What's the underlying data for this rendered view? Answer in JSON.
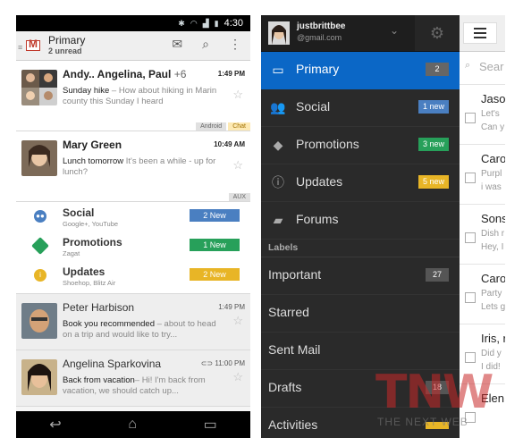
{
  "left": {
    "status_bar": {
      "time": "4:30"
    },
    "action_bar": {
      "title": "Primary",
      "subtitle": "2 unread"
    },
    "emails_top": [
      {
        "sender": "Andy.. Angelina, Paul",
        "more": "+6",
        "time": "1:49 PM",
        "subject": "Sunday hike",
        "snippet": " – How about hiking in Marin county this Sunday I heard",
        "labels": [
          "Android",
          "Chat"
        ]
      },
      {
        "sender": "Mary Green",
        "more": "",
        "time": "10:49 AM",
        "subject": "Lunch tomorrow",
        "snippet": " It's been a while - up for lunch?",
        "labels": [
          "AUX"
        ]
      }
    ],
    "categories": [
      {
        "name": "Social",
        "sub": "Google+, YouTube",
        "badge": "2 New",
        "color": "#4a7fc1"
      },
      {
        "name": "Promotions",
        "sub": "Zagat",
        "badge": "1 New",
        "color": "#27a05a"
      },
      {
        "name": "Updates",
        "sub": "Shoehop, Blitz Air",
        "badge": "2 New",
        "color": "#e8b526"
      }
    ],
    "emails_bottom": [
      {
        "sender": "Peter Harbison",
        "time": "1:49 PM",
        "subject": "Book you recommended",
        "snippet": " – about to head on a trip and would like to try..."
      },
      {
        "sender": "Angelina Sparkovina",
        "time": "11:00 PM",
        "subject": "Back from vacation",
        "snippet": "– Hi! I'm back from vacation, we should catch up..."
      }
    ]
  },
  "right": {
    "account": {
      "name": "justbrittbee",
      "email": "@gmail.com"
    },
    "inbox_items": [
      {
        "label": "Primary",
        "badge": "2",
        "badge_color": "#666666",
        "icon": "inbox-icon",
        "active": true
      },
      {
        "label": "Social",
        "badge": "1 new",
        "badge_color": "#4a7fc1",
        "icon": "people-icon",
        "active": false
      },
      {
        "label": "Promotions",
        "badge": "3 new",
        "badge_color": "#27a05a",
        "icon": "tag-icon",
        "active": false
      },
      {
        "label": "Updates",
        "badge": "5 new",
        "badge_color": "#e8b526",
        "icon": "info-icon",
        "active": false
      },
      {
        "label": "Forums",
        "badge": "",
        "badge_color": "",
        "icon": "forum-icon",
        "active": false
      }
    ],
    "labels_heading": "Labels",
    "label_items": [
      {
        "label": "Important",
        "badge": "27",
        "badge_color": "#555555"
      },
      {
        "label": "Starred",
        "badge": "",
        "badge_color": ""
      },
      {
        "label": "Sent Mail",
        "badge": "",
        "badge_color": ""
      },
      {
        "label": "Drafts",
        "badge": "18",
        "badge_color": "#555555"
      },
      {
        "label": "Activities",
        "badge": "",
        "badge_color": "#e8b526"
      }
    ],
    "list_peek": {
      "search_placeholder": "Sear",
      "items": [
        {
          "name": "Jaso",
          "l1": "Let's",
          "l2": "Can y"
        },
        {
          "name": "Caro",
          "l1": "Purpl",
          "l2": "i was"
        },
        {
          "name": "Sons",
          "l1": "Dish r",
          "l2": "Hey, I"
        },
        {
          "name": "Caro",
          "l1": "Party",
          "l2": "Lets g"
        },
        {
          "name": "Iris, r",
          "l1": "Did y",
          "l2": "I did!"
        },
        {
          "name": "Elen",
          "l1": "",
          "l2": ""
        }
      ]
    }
  },
  "watermark": {
    "big": "TNW",
    "small": "THE NEXT WEB"
  }
}
